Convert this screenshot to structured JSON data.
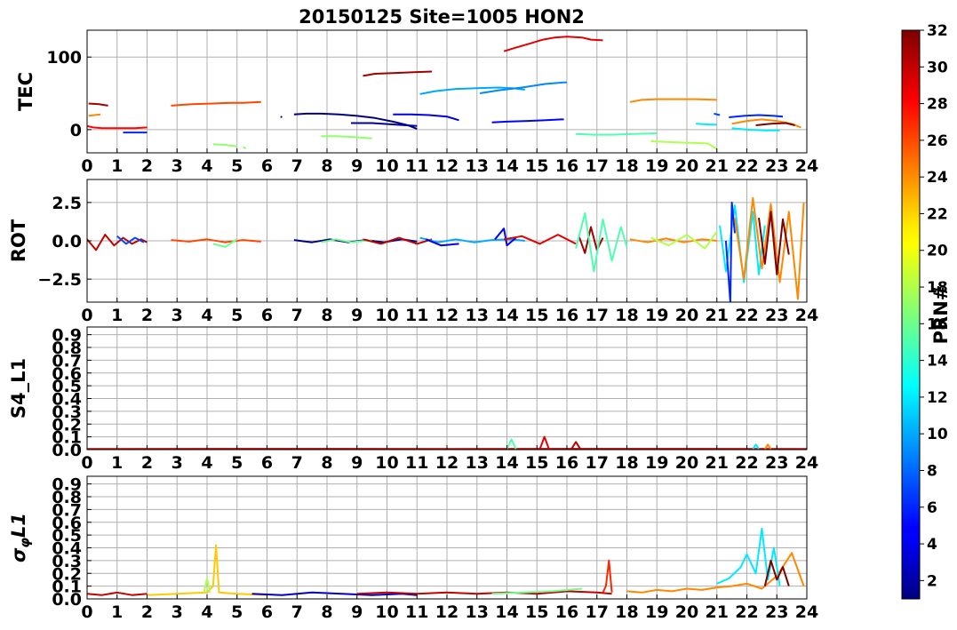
{
  "chart_data": [
    {
      "type": "line",
      "title": "20150125 Site=1005 HON2",
      "ylabel": "TEC",
      "xlim": [
        0,
        24
      ],
      "ylim": [
        -32,
        137
      ],
      "yticks": [
        0,
        100
      ],
      "grid": true,
      "series": [
        {
          "prn": 28,
          "x": [
            0.0,
            0.2,
            0.5,
            0.8,
            1.0,
            1.3,
            1.6,
            2.0
          ],
          "y": [
            5,
            3,
            2,
            2,
            2,
            2,
            2,
            3
          ]
        },
        {
          "prn": 31,
          "x": [
            0.05,
            0.4,
            0.7
          ],
          "y": [
            36,
            35,
            33
          ]
        },
        {
          "prn": 24,
          "x": [
            0.05,
            0.25,
            0.45
          ],
          "y": [
            19,
            20,
            21
          ]
        },
        {
          "prn": 6,
          "x": [
            1.2,
            1.5,
            1.8,
            2.0
          ],
          "y": [
            -4,
            -4,
            -4,
            -4
          ]
        },
        {
          "prn": 26,
          "x": [
            2.8,
            3.5,
            4.2,
            4.8,
            5.2,
            5.8
          ],
          "y": [
            33,
            35,
            36,
            37,
            37,
            38
          ]
        },
        {
          "prn": 17,
          "x": [
            4.2,
            4.6,
            5.0
          ],
          "y": [
            -20,
            -21,
            -23
          ]
        },
        {
          "prn": 17,
          "x": [
            5.2,
            5.3
          ],
          "y": [
            -24,
            -26
          ]
        },
        {
          "prn": 3,
          "x": [
            6.45,
            6.5
          ],
          "y": [
            18,
            17
          ]
        },
        {
          "prn": 1,
          "x": [
            6.9,
            7.3,
            7.8,
            8.4,
            9.0,
            9.6,
            10.2,
            10.7,
            11.0
          ],
          "y": [
            21,
            22,
            22,
            21,
            19,
            16,
            11,
            6,
            1
          ]
        },
        {
          "prn": 2,
          "x": [
            8.8,
            9.5,
            10.3,
            11.0
          ],
          "y": [
            9,
            9,
            7,
            5
          ]
        },
        {
          "prn": 17,
          "x": [
            7.8,
            8.3,
            8.8,
            9.5
          ],
          "y": [
            -9,
            -9,
            -10,
            -12
          ]
        },
        {
          "prn": 31,
          "x": [
            9.2,
            9.6,
            10.2,
            10.8,
            11.5
          ],
          "y": [
            74,
            77,
            78,
            79,
            80
          ]
        },
        {
          "prn": 4,
          "x": [
            10.2,
            10.8,
            11.4,
            12.0,
            12.4
          ],
          "y": [
            21,
            21,
            20,
            18,
            13
          ]
        },
        {
          "prn": 10,
          "x": [
            11.1,
            11.6,
            12.3,
            13.0,
            13.7,
            14.2,
            14.6
          ],
          "y": [
            49,
            53,
            56,
            57,
            58,
            57,
            55
          ]
        },
        {
          "prn": 9,
          "x": [
            13.1,
            13.7,
            14.5,
            15.3,
            15.9,
            16.0
          ],
          "y": [
            50,
            54,
            58,
            63,
            65,
            65
          ]
        },
        {
          "prn": 5,
          "x": [
            13.5,
            14.0,
            14.7,
            15.3,
            15.8,
            15.9
          ],
          "y": [
            10,
            11,
            12,
            13,
            14,
            14
          ]
        },
        {
          "prn": 29,
          "x": [
            13.9,
            14.3,
            14.8,
            15.2,
            15.6,
            16.0,
            16.5,
            16.8,
            17.2
          ],
          "y": [
            108,
            113,
            119,
            124,
            127,
            128,
            127,
            124,
            123
          ]
        },
        {
          "prn": 15,
          "x": [
            16.3,
            16.9,
            17.5,
            18.2,
            19.0
          ],
          "y": [
            -6,
            -7,
            -7,
            -6,
            -5
          ]
        },
        {
          "prn": 24,
          "x": [
            18.1,
            18.5,
            19.0,
            19.6,
            20.3,
            21.0
          ],
          "y": [
            38,
            41,
            42,
            42,
            42,
            41
          ]
        },
        {
          "prn": 18,
          "x": [
            18.8,
            19.3,
            20.0,
            20.7,
            21.0
          ],
          "y": [
            -16,
            -17,
            -18,
            -19,
            -27
          ]
        },
        {
          "prn": 12,
          "x": [
            20.3,
            20.8,
            21.0
          ],
          "y": [
            8,
            7,
            7
          ]
        },
        {
          "prn": 7,
          "x": [
            20.9,
            21.1
          ],
          "y": [
            22,
            20
          ]
        },
        {
          "prn": 6,
          "x": [
            21.4,
            21.9,
            22.4,
            22.9,
            23.2
          ],
          "y": [
            17,
            19,
            20,
            19,
            18
          ]
        },
        {
          "prn": 24,
          "x": [
            21.5,
            22.0,
            22.5,
            23.0,
            23.5,
            23.8
          ],
          "y": [
            8,
            12,
            14,
            12,
            8,
            3
          ]
        },
        {
          "prn": 12,
          "x": [
            21.5,
            22.0,
            22.6,
            23.1
          ],
          "y": [
            2,
            0,
            -1,
            -1
          ]
        },
        {
          "prn": 32,
          "x": [
            22.3,
            22.8,
            23.3,
            23.6
          ],
          "y": [
            6,
            8,
            9,
            6
          ]
        }
      ]
    },
    {
      "type": "line",
      "ylabel": "ROT",
      "xlim": [
        0,
        24
      ],
      "ylim": [
        -4.0,
        4.0
      ],
      "yticks": [
        -2.5,
        0.0,
        2.5
      ],
      "grid": true,
      "series": [
        {
          "prn": 30,
          "x": [
            0.0,
            0.3,
            0.6,
            0.9,
            1.2,
            1.5,
            1.8,
            2.0
          ],
          "y": [
            0.1,
            -0.6,
            0.4,
            -0.3,
            0.2,
            -0.2,
            0.1,
            -0.1
          ]
        },
        {
          "prn": 7,
          "x": [
            1.0,
            1.3,
            1.6,
            1.9
          ],
          "y": [
            0.3,
            -0.2,
            0.2,
            -0.1
          ]
        },
        {
          "prn": 26,
          "x": [
            2.8,
            3.4,
            4.0,
            4.6,
            5.2,
            5.8
          ],
          "y": [
            0.05,
            -0.05,
            0.1,
            -0.1,
            0.05,
            -0.05
          ]
        },
        {
          "prn": 16,
          "x": [
            4.2,
            4.6,
            5.0
          ],
          "y": [
            -0.2,
            -0.4,
            0.1
          ]
        },
        {
          "prn": 1,
          "x": [
            6.9,
            7.5,
            8.1,
            8.7,
            9.3,
            9.9,
            10.5,
            11.0
          ],
          "y": [
            0.05,
            -0.1,
            0.1,
            -0.1,
            0.05,
            -0.1,
            0.1,
            -0.05
          ]
        },
        {
          "prn": 16,
          "x": [
            7.8,
            8.3,
            8.8,
            9.5
          ],
          "y": [
            -0.1,
            0.1,
            -0.1,
            0.05
          ]
        },
        {
          "prn": 30,
          "x": [
            9.2,
            9.8,
            10.4,
            11.0,
            11.5
          ],
          "y": [
            0.1,
            -0.2,
            0.2,
            -0.2,
            0.1
          ]
        },
        {
          "prn": 10,
          "x": [
            11.1,
            11.7,
            12.3,
            12.9,
            13.5,
            14.1,
            14.6
          ],
          "y": [
            0.2,
            -0.1,
            0.1,
            -0.1,
            0.05,
            0.1,
            0.0
          ]
        },
        {
          "prn": 4,
          "x": [
            11.3,
            11.8,
            12.4
          ],
          "y": [
            0.1,
            -0.3,
            -0.2
          ]
        },
        {
          "prn": 5,
          "x": [
            13.6,
            13.9,
            14.0,
            14.3
          ],
          "y": [
            0.1,
            0.8,
            -0.3,
            0.2
          ]
        },
        {
          "prn": 29,
          "x": [
            13.9,
            14.5,
            15.1,
            15.7,
            16.3
          ],
          "y": [
            0.1,
            0.3,
            -0.2,
            0.4,
            -0.2
          ]
        },
        {
          "prn": 31,
          "x": [
            16.4,
            16.6,
            16.8,
            17.0,
            17.2
          ],
          "y": [
            0.3,
            -0.8,
            0.9,
            -0.6,
            0.2
          ]
        },
        {
          "prn": 15,
          "x": [
            16.3,
            16.6,
            16.9,
            17.2,
            17.5,
            17.8,
            18.0
          ],
          "y": [
            -0.5,
            1.8,
            -2.0,
            1.4,
            -1.3,
            0.9,
            -0.4
          ]
        },
        {
          "prn": 24,
          "x": [
            18.1,
            18.7,
            19.3,
            19.9,
            20.5,
            21.0
          ],
          "y": [
            0.1,
            -0.1,
            0.15,
            -0.1,
            0.1,
            0.0
          ]
        },
        {
          "prn": 18,
          "x": [
            18.8,
            19.4,
            20.0,
            20.6,
            21.0
          ],
          "y": [
            0.2,
            -0.3,
            0.4,
            -0.5,
            0.6
          ]
        },
        {
          "prn": 12,
          "x": [
            21.1,
            21.3,
            21.6,
            21.9,
            22.2,
            22.4,
            22.6
          ],
          "y": [
            1.0,
            -2.0,
            2.3,
            -2.7,
            1.9,
            -2.2,
            1.0
          ]
        },
        {
          "prn": 6,
          "x": [
            21.3,
            21.45,
            21.5,
            21.6
          ],
          "y": [
            0.0,
            -4.0,
            2.5,
            0.5
          ]
        },
        {
          "prn": 24,
          "x": [
            21.6,
            21.9,
            22.2,
            22.5,
            22.8,
            23.1,
            23.4,
            23.7,
            23.9
          ],
          "y": [
            1.5,
            -2.5,
            2.8,
            -1.8,
            2.4,
            -2.7,
            1.9,
            -3.8,
            2.5
          ]
        },
        {
          "prn": 32,
          "x": [
            22.4,
            22.6,
            22.8,
            23.0,
            23.2,
            23.4
          ],
          "y": [
            1.5,
            -1.5,
            1.9,
            -2.2,
            1.4,
            -0.9
          ]
        }
      ]
    },
    {
      "type": "line",
      "ylabel": "S4_L1",
      "xlim": [
        0,
        24
      ],
      "ylim": [
        0.0,
        0.96
      ],
      "yticks": [
        0.0,
        0.1,
        0.2,
        0.3,
        0.4,
        0.5,
        0.6,
        0.7,
        0.8,
        0.9
      ],
      "grid": true,
      "series": [
        {
          "prn": 30,
          "x": [
            0.0,
            6.0,
            12.0,
            18.0,
            24.0
          ],
          "y": [
            0.005,
            0.006,
            0.005,
            0.006,
            0.005
          ]
        },
        {
          "prn": 15,
          "x": [
            14.0,
            14.15,
            14.3
          ],
          "y": [
            0.005,
            0.08,
            0.005
          ]
        },
        {
          "prn": 29,
          "x": [
            15.1,
            15.25,
            15.4
          ],
          "y": [
            0.005,
            0.1,
            0.005
          ]
        },
        {
          "prn": 30,
          "x": [
            16.15,
            16.3,
            16.45
          ],
          "y": [
            0.005,
            0.06,
            0.005
          ]
        },
        {
          "prn": 12,
          "x": [
            22.2,
            22.3,
            22.4
          ],
          "y": [
            0.005,
            0.04,
            0.005
          ]
        },
        {
          "prn": 24,
          "x": [
            22.6,
            22.7,
            22.8
          ],
          "y": [
            0.005,
            0.04,
            0.005
          ]
        }
      ]
    },
    {
      "type": "line",
      "ylabel": "σφL1",
      "xlim": [
        0,
        24
      ],
      "ylim": [
        0.0,
        0.96
      ],
      "yticks": [
        0.0,
        0.1,
        0.2,
        0.3,
        0.4,
        0.5,
        0.6,
        0.7,
        0.8,
        0.9
      ],
      "grid": true,
      "series": [
        {
          "prn": 30,
          "x": [
            0.0,
            0.5,
            1.0,
            1.5,
            2.0
          ],
          "y": [
            0.04,
            0.03,
            0.05,
            0.03,
            0.04
          ]
        },
        {
          "prn": 22,
          "x": [
            2.0,
            3.0,
            4.0,
            4.2,
            4.3,
            4.4,
            5.0,
            6.0
          ],
          "y": [
            0.03,
            0.04,
            0.05,
            0.1,
            0.42,
            0.05,
            0.04,
            0.03
          ]
        },
        {
          "prn": 18,
          "x": [
            3.9,
            4.0,
            4.1
          ],
          "y": [
            0.05,
            0.16,
            0.05
          ]
        },
        {
          "prn": 3,
          "x": [
            5.5,
            6.5,
            7.5,
            8.5,
            9.5,
            10.5,
            11.0
          ],
          "y": [
            0.04,
            0.03,
            0.05,
            0.04,
            0.03,
            0.04,
            0.03
          ]
        },
        {
          "prn": 30,
          "x": [
            9.0,
            10.0,
            11.0,
            12.0,
            13.0,
            14.0,
            15.0,
            16.0,
            17.0,
            17.5
          ],
          "y": [
            0.04,
            0.05,
            0.04,
            0.05,
            0.04,
            0.05,
            0.04,
            0.06,
            0.05,
            0.04
          ]
        },
        {
          "prn": 27,
          "x": [
            17.2,
            17.3,
            17.4,
            17.5
          ],
          "y": [
            0.05,
            0.1,
            0.3,
            0.05
          ]
        },
        {
          "prn": 16,
          "x": [
            13.5,
            14.5,
            15.5,
            16.5
          ],
          "y": [
            0.04,
            0.05,
            0.06,
            0.08
          ]
        },
        {
          "prn": 24,
          "x": [
            18.0,
            18.5,
            19.0,
            19.5,
            20.0,
            20.5,
            21.0,
            21.5,
            22.0,
            22.5,
            23.0,
            23.5,
            23.9
          ],
          "y": [
            0.06,
            0.05,
            0.07,
            0.06,
            0.08,
            0.07,
            0.09,
            0.1,
            0.12,
            0.08,
            0.18,
            0.36,
            0.1
          ]
        },
        {
          "prn": 12,
          "x": [
            21.0,
            21.4,
            21.8,
            22.0,
            22.3,
            22.5,
            22.7,
            22.9,
            23.1
          ],
          "y": [
            0.12,
            0.16,
            0.25,
            0.35,
            0.2,
            0.55,
            0.15,
            0.4,
            0.1
          ]
        },
        {
          "prn": 32,
          "x": [
            22.6,
            22.8,
            23.0,
            23.2,
            23.4
          ],
          "y": [
            0.1,
            0.3,
            0.15,
            0.25,
            0.1
          ]
        }
      ]
    }
  ],
  "colorbar": {
    "label": "PRN#",
    "min": 1,
    "max": 32,
    "ticks": [
      2,
      4,
      6,
      8,
      10,
      12,
      14,
      16,
      18,
      20,
      22,
      24,
      26,
      28,
      30,
      32
    ],
    "colormap": "jet"
  },
  "xticks": [
    "0",
    "1",
    "2",
    "3",
    "4",
    "5",
    "6",
    "7",
    "8",
    "9",
    "10",
    "11",
    "12",
    "13",
    "14",
    "15",
    "16",
    "17",
    "18",
    "19",
    "20",
    "21",
    "22",
    "23",
    "24"
  ]
}
